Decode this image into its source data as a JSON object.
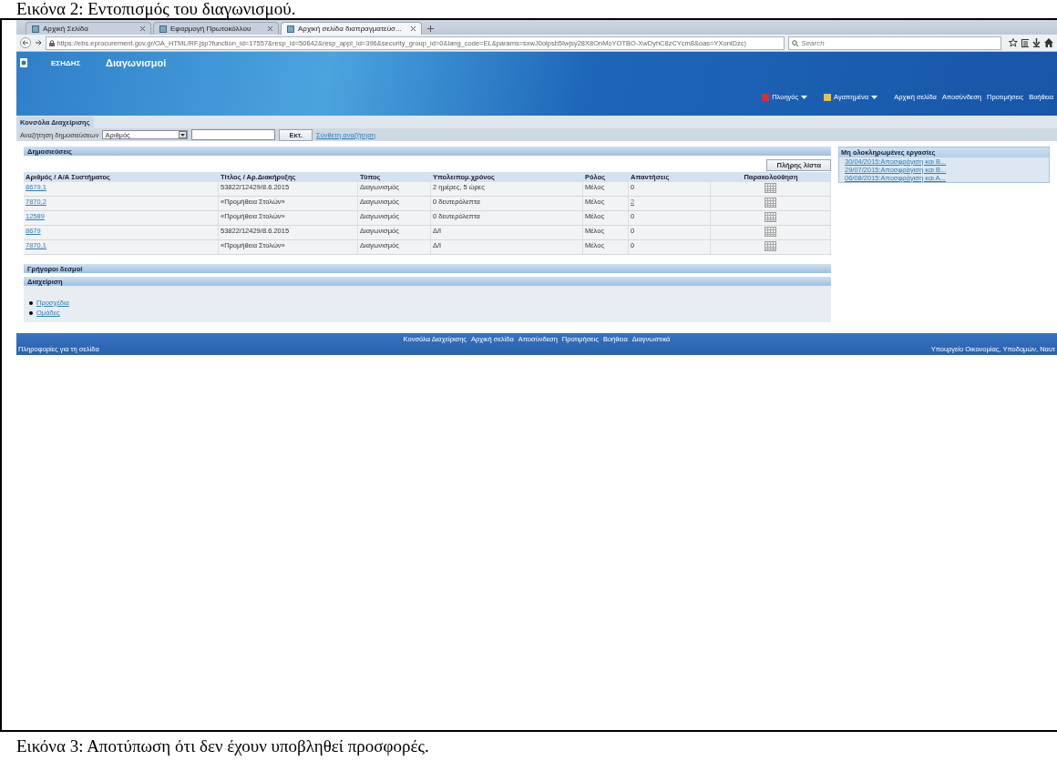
{
  "caption_top": "Εικόνα 2: Εντοπισμός του διαγωνισμού.",
  "browser": {
    "tabs": [
      {
        "label": "Αρχική Σελίδα",
        "selected": false
      },
      {
        "label": "Εφαρμογή Πρωτοκόλλου",
        "selected": false
      },
      {
        "label": "Αρχική σελίδα διαπραγματεύσ...",
        "selected": true
      }
    ],
    "url": "https://ebs.eprocurement.gov.gr/OA_HTML/RF.jsp?function_id=17557&resp_id=50642&resp_appl_id=396&security_group_id=0&lang_code=EL&params=sxwJ0olpsb5Iwjsy28X8OnMoYOTBO-XwDyhC8zCYcm8&oas=YXoniDzc)",
    "search_placeholder": "Search"
  },
  "app": {
    "brand": "ΕΣΗΔΗΣ",
    "title": "Διαγωνισμοί",
    "menus": [
      "Πλοηγός",
      "Αγαπημένα"
    ],
    "global_links": [
      "Αρχική σελίδα",
      "Αποσύνδεση",
      "Προτιμήσεις",
      "Βοήθεια"
    ],
    "console_tab": {
      "label": "Κονσόλα Διαχείρισης",
      "selected": true
    }
  },
  "search": {
    "label": "Αναζήτηση δημοσιεύσεων",
    "select_value": "Αριθμός",
    "button": "Εκτ.",
    "advanced_link": "Σύνθετη αναζήτηση"
  },
  "publications": {
    "title": "Δημοσιεύσεις",
    "full_list_button": "Πλήρης λίστα",
    "columns": [
      "Αριθμός / Α/Α Συστήματος",
      "Τίτλος / Αρ.Διακήρυξης",
      "Τύπος",
      "Υπολειπομ.χρόνος",
      "Ρόλος",
      "Απαντήσεις",
      "Παρακολούθηση"
    ],
    "rows": [
      {
        "number": "8679,1",
        "title": "53822/12429/8.6.2015",
        "type": "Διαγωνισμός",
        "remaining": "2 ημέρες, 5 ώρες",
        "role": "Μέλος",
        "responses": "0",
        "responses_link": false
      },
      {
        "number": "7870,2",
        "title": "«Προμήθεια Στολών»",
        "type": "Διαγωνισμός",
        "remaining": "0 δευτερόλεπτα",
        "role": "Μέλος",
        "responses": "2",
        "responses_link": true
      },
      {
        "number": "12589",
        "title": "«Προμήθεια Στολών»",
        "type": "Διαγωνισμός",
        "remaining": "0 δευτερόλεπτα",
        "role": "Μέλος",
        "responses": "0",
        "responses_link": false
      },
      {
        "number": "8679",
        "title": "53822/12429/8.6.2015",
        "type": "Διαγωνισμός",
        "remaining": "Δ/Ι",
        "role": "Μέλος",
        "responses": "0",
        "responses_link": false
      },
      {
        "number": "7870,1",
        "title": "«Προμήθεια Στολών»",
        "type": "Διαγωνισμός",
        "remaining": "Δ/Ι",
        "role": "Μέλος",
        "responses": "0",
        "responses_link": false
      }
    ]
  },
  "quick_links": {
    "title": "Γρήγοροι δεσμοί"
  },
  "admin": {
    "title": "Διαχείριση",
    "links": [
      "Προσχέδια",
      "Ομάδες"
    ]
  },
  "sidebar": {
    "title": "Μη ολοκληρωμένες εργασίες",
    "items": [
      "30/04/2015:Αποσφράγιση και Β...",
      "29/07/2015:Αποσφράγιση και Β...",
      "06/08/2015:Αποσφράγιση και Α..."
    ]
  },
  "footer": {
    "links": [
      "Κονσόλα Διαχείρισης",
      "Αρχική σελίδα",
      "Αποσύνδεση",
      "Προτιμήσεις",
      "Βοήθεια",
      "Διαγνωστικά"
    ],
    "info": "Πληροφορίες για τη σελίδα",
    "ministry": "Υπουργείο Οικονομίας, Υποδομών, Ναυτ"
  },
  "caption_bottom": "Εικόνα 3: Αποτύπωση ότι δεν έχουν υποβληθεί προσφορές."
}
